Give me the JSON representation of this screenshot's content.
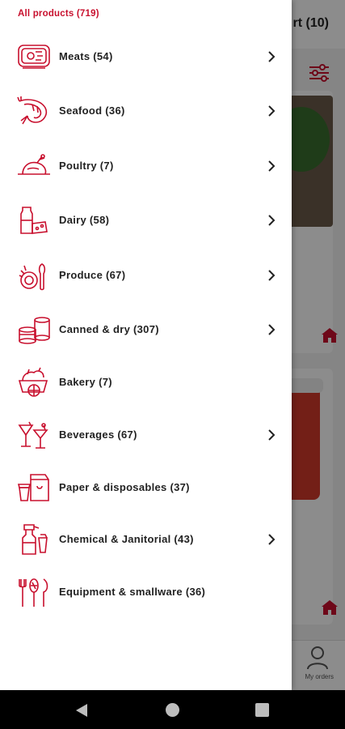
{
  "background": {
    "cart_label": "rt (10)",
    "nav_label": "My orders"
  },
  "drawer": {
    "title": "All products (719)",
    "categories": [
      {
        "label": "Meats (54)",
        "icon": "meat-icon",
        "chevron": true
      },
      {
        "label": "Seafood (36)",
        "icon": "shrimp-icon",
        "chevron": true
      },
      {
        "label": "Poultry (7)",
        "icon": "chicken-icon",
        "chevron": true
      },
      {
        "label": "Dairy (58)",
        "icon": "milk-cheese-icon",
        "chevron": true
      },
      {
        "label": "Produce (67)",
        "icon": "vegetables-icon",
        "chevron": true
      },
      {
        "label": "Canned & dry (307)",
        "icon": "cans-icon",
        "chevron": true
      },
      {
        "label": "Bakery (7)",
        "icon": "bread-basket-icon",
        "chevron": false
      },
      {
        "label": "Beverages (67)",
        "icon": "cocktail-icon",
        "chevron": true
      },
      {
        "label": "Paper & disposables (37)",
        "icon": "paper-bag-icon",
        "chevron": false
      },
      {
        "label": "Chemical & Janitorial (43)",
        "icon": "spray-bottle-icon",
        "chevron": true
      },
      {
        "label": "Equipment & smallware (36)",
        "icon": "utensils-icon",
        "chevron": false
      }
    ]
  },
  "colors": {
    "accent": "#c8102e",
    "text": "#222222"
  }
}
